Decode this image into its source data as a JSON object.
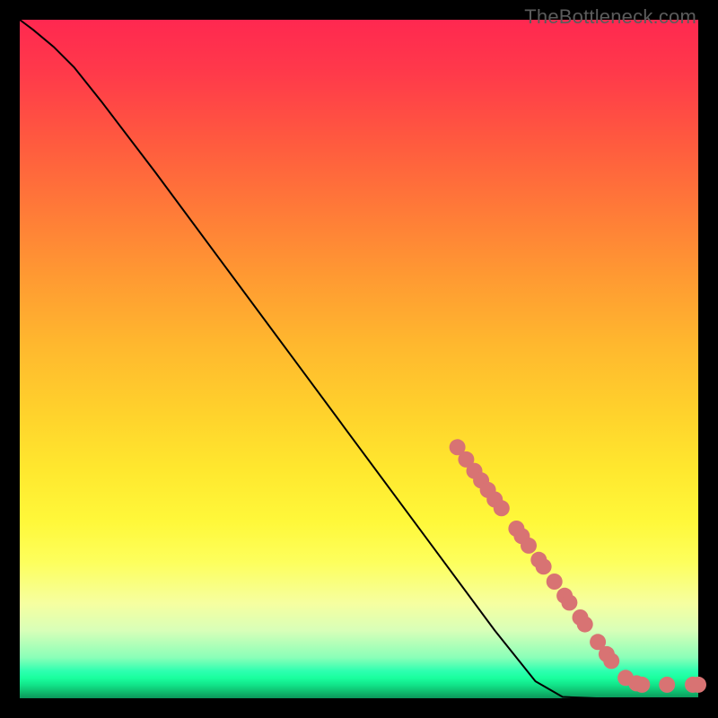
{
  "watermark": "TheBottleneck.com",
  "chart_data": {
    "type": "line",
    "title": "",
    "xlabel": "",
    "ylabel": "",
    "xlim": [
      0,
      100
    ],
    "ylim": [
      0,
      100
    ],
    "curve": [
      {
        "x": 0,
        "y": 100
      },
      {
        "x": 2,
        "y": 98.5
      },
      {
        "x": 5,
        "y": 96
      },
      {
        "x": 8,
        "y": 93
      },
      {
        "x": 12,
        "y": 88
      },
      {
        "x": 20,
        "y": 77.5
      },
      {
        "x": 30,
        "y": 64
      },
      {
        "x": 40,
        "y": 50.5
      },
      {
        "x": 50,
        "y": 37
      },
      {
        "x": 60,
        "y": 23.5
      },
      {
        "x": 70,
        "y": 10
      },
      {
        "x": 76,
        "y": 2.5
      },
      {
        "x": 80,
        "y": 0.2
      },
      {
        "x": 85,
        "y": 0
      },
      {
        "x": 90,
        "y": 0
      },
      {
        "x": 95,
        "y": 0
      },
      {
        "x": 100,
        "y": 0
      }
    ],
    "markers": [
      {
        "x": 64.5,
        "y": 37.0
      },
      {
        "x": 65.8,
        "y": 35.2
      },
      {
        "x": 67.0,
        "y": 33.5
      },
      {
        "x": 68.0,
        "y": 32.1
      },
      {
        "x": 69.0,
        "y": 30.7
      },
      {
        "x": 70.0,
        "y": 29.3
      },
      {
        "x": 71.0,
        "y": 28.0
      },
      {
        "x": 73.2,
        "y": 25.0
      },
      {
        "x": 74.0,
        "y": 23.9
      },
      {
        "x": 75.0,
        "y": 22.5
      },
      {
        "x": 76.5,
        "y": 20.4
      },
      {
        "x": 77.2,
        "y": 19.4
      },
      {
        "x": 78.8,
        "y": 17.2
      },
      {
        "x": 80.3,
        "y": 15.1
      },
      {
        "x": 81.0,
        "y": 14.1
      },
      {
        "x": 82.6,
        "y": 11.9
      },
      {
        "x": 83.3,
        "y": 10.9
      },
      {
        "x": 85.2,
        "y": 8.3
      },
      {
        "x": 86.5,
        "y": 6.5
      },
      {
        "x": 87.2,
        "y": 5.5
      },
      {
        "x": 89.3,
        "y": 3.0
      },
      {
        "x": 90.9,
        "y": 2.2
      },
      {
        "x": 91.7,
        "y": 2.0
      },
      {
        "x": 95.4,
        "y": 2.0
      },
      {
        "x": 99.2,
        "y": 2.0
      },
      {
        "x": 100.0,
        "y": 2.0
      }
    ],
    "marker_color": "#d87373",
    "line_color": "#000000"
  }
}
